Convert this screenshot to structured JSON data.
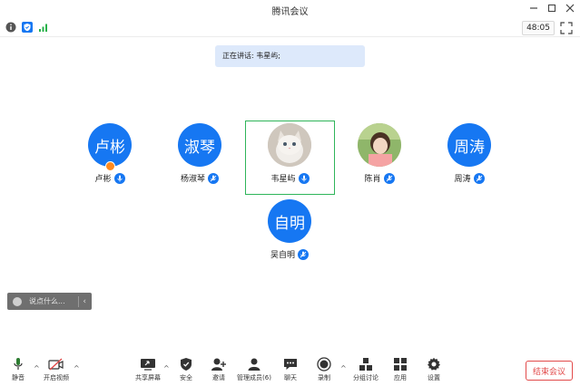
{
  "window": {
    "title": "腾讯会议"
  },
  "status": {
    "timer": "48:05"
  },
  "speaking": {
    "text": "正在讲话: 韦星屿;"
  },
  "participants": [
    {
      "avatar_text": "卢彬",
      "name": "卢彬",
      "host": true
    },
    {
      "avatar_text": "淑琴",
      "name": "杨淑琴"
    },
    {
      "avatar_text": "",
      "name": "韦星屿",
      "active": true,
      "avatar_image": "cat-photo"
    },
    {
      "avatar_text": "",
      "name": "陈肖",
      "avatar_image": "person-photo"
    },
    {
      "avatar_text": "周涛",
      "name": "周涛"
    },
    {
      "avatar_text": "自明",
      "name": "吴自明"
    }
  ],
  "chat": {
    "placeholder": "说点什么..."
  },
  "toolbar": {
    "mute": "静音",
    "video": "开启视频",
    "share": "共享屏幕",
    "security": "安全",
    "invite": "邀请",
    "members": "管理成员(6)",
    "chat": "聊天",
    "record": "录制",
    "breakout": "分组讨论",
    "apps": "应用",
    "settings": "设置",
    "end": "结束会议"
  },
  "colors": {
    "accent": "#1677f2",
    "active_border": "#2fb55a",
    "end": "#e24a4a"
  }
}
